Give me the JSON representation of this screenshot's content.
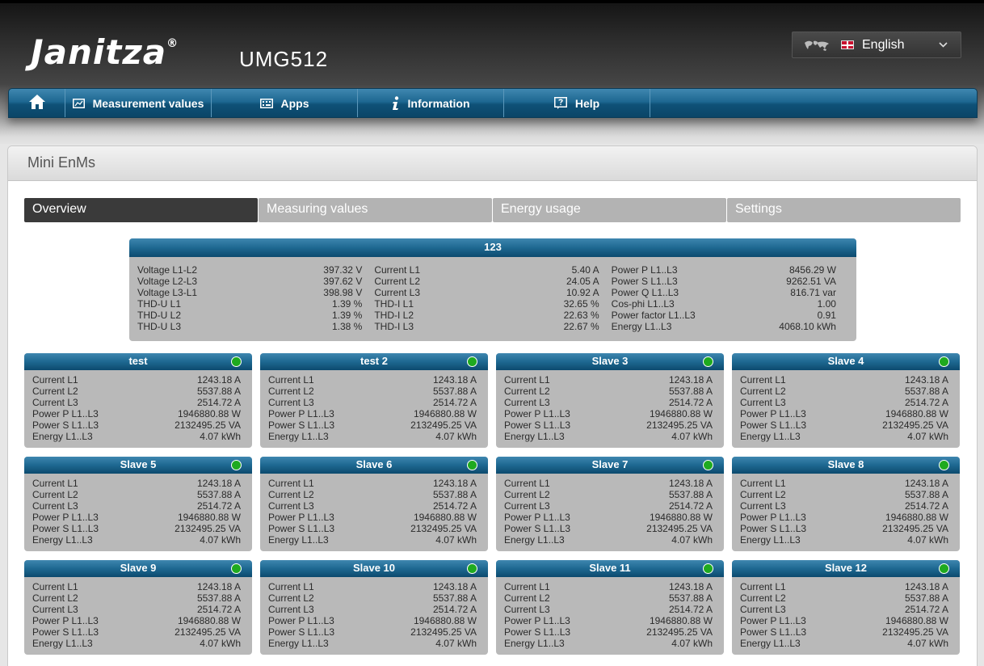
{
  "header": {
    "logo": "Janitza",
    "logo_mark": "®",
    "model": "UMG512",
    "language": {
      "icon": "globe-icon",
      "flag": "uk-flag-icon",
      "label": "English"
    }
  },
  "nav": {
    "home_icon": "home-icon",
    "items": [
      {
        "label": "Measurement values",
        "icon": "chart-icon"
      },
      {
        "label": "Apps",
        "icon": "apps-icon"
      },
      {
        "label": "Information",
        "icon": "info-icon"
      },
      {
        "label": "Help",
        "icon": "help-icon"
      }
    ]
  },
  "panel": {
    "title": "Mini EnMs"
  },
  "tabs": [
    {
      "label": "Overview",
      "active": true
    },
    {
      "label": "Measuring values",
      "active": false
    },
    {
      "label": "Energy usage",
      "active": false
    },
    {
      "label": "Settings",
      "active": false
    }
  ],
  "main_device": {
    "title": "123",
    "columns": [
      [
        {
          "label": "Voltage L1-L2",
          "value": "397.32 V"
        },
        {
          "label": "Voltage L2-L3",
          "value": "397.62 V"
        },
        {
          "label": "Voltage L3-L1",
          "value": "398.98 V"
        },
        {
          "label": "THD-U L1",
          "value": "1.39 %"
        },
        {
          "label": "THD-U L2",
          "value": "1.39 %"
        },
        {
          "label": "THD-U L3",
          "value": "1.38 %"
        }
      ],
      [
        {
          "label": "Current L1",
          "value": "5.40 A"
        },
        {
          "label": "Current L2",
          "value": "24.05 A"
        },
        {
          "label": "Current L3",
          "value": "10.92 A"
        },
        {
          "label": "THD-I L1",
          "value": "32.65 %"
        },
        {
          "label": "THD-I L2",
          "value": "22.63 %"
        },
        {
          "label": "THD-I L3",
          "value": "22.67 %"
        }
      ],
      [
        {
          "label": "Power P L1..L3",
          "value": "8456.29 W"
        },
        {
          "label": "Power S L1..L3",
          "value": "9262.51 VA"
        },
        {
          "label": "Power Q L1..L3",
          "value": "816.71 var"
        },
        {
          "label": "Cos-phi L1..L3",
          "value": "1.00"
        },
        {
          "label": "Power factor L1..L3",
          "value": "0.91"
        },
        {
          "label": "Energy L1..L3",
          "value": "4068.10 kWh"
        }
      ]
    ]
  },
  "slaves": [
    {
      "title": "test",
      "status": "online",
      "rows": [
        {
          "label": "Current L1",
          "value": "1243.18 A"
        },
        {
          "label": "Current L2",
          "value": "5537.88 A"
        },
        {
          "label": "Current L3",
          "value": "2514.72 A"
        },
        {
          "label": "Power P L1..L3",
          "value": "1946880.88 W"
        },
        {
          "label": "Power S L1..L3",
          "value": "2132495.25 VA"
        },
        {
          "label": "Energy L1..L3",
          "value": "4.07 kWh"
        }
      ]
    },
    {
      "title": "test 2",
      "status": "online",
      "rows": [
        {
          "label": "Current L1",
          "value": "1243.18 A"
        },
        {
          "label": "Current L2",
          "value": "5537.88 A"
        },
        {
          "label": "Current L3",
          "value": "2514.72 A"
        },
        {
          "label": "Power P L1..L3",
          "value": "1946880.88 W"
        },
        {
          "label": "Power S L1..L3",
          "value": "2132495.25 VA"
        },
        {
          "label": "Energy L1..L3",
          "value": "4.07 kWh"
        }
      ]
    },
    {
      "title": "Slave 3",
      "status": "online",
      "rows": [
        {
          "label": "Current L1",
          "value": "1243.18 A"
        },
        {
          "label": "Current L2",
          "value": "5537.88 A"
        },
        {
          "label": "Current L3",
          "value": "2514.72 A"
        },
        {
          "label": "Power P L1..L3",
          "value": "1946880.88 W"
        },
        {
          "label": "Power S L1..L3",
          "value": "2132495.25 VA"
        },
        {
          "label": "Energy L1..L3",
          "value": "4.07 kWh"
        }
      ]
    },
    {
      "title": "Slave 4",
      "status": "online",
      "rows": [
        {
          "label": "Current L1",
          "value": "1243.18 A"
        },
        {
          "label": "Current L2",
          "value": "5537.88 A"
        },
        {
          "label": "Current L3",
          "value": "2514.72 A"
        },
        {
          "label": "Power P L1..L3",
          "value": "1946880.88 W"
        },
        {
          "label": "Power S L1..L3",
          "value": "2132495.25 VA"
        },
        {
          "label": "Energy L1..L3",
          "value": "4.07 kWh"
        }
      ]
    },
    {
      "title": "Slave 5",
      "status": "online",
      "rows": [
        {
          "label": "Current L1",
          "value": "1243.18 A"
        },
        {
          "label": "Current L2",
          "value": "5537.88 A"
        },
        {
          "label": "Current L3",
          "value": "2514.72 A"
        },
        {
          "label": "Power P L1..L3",
          "value": "1946880.88 W"
        },
        {
          "label": "Power S L1..L3",
          "value": "2132495.25 VA"
        },
        {
          "label": "Energy L1..L3",
          "value": "4.07 kWh"
        }
      ]
    },
    {
      "title": "Slave 6",
      "status": "online",
      "rows": [
        {
          "label": "Current L1",
          "value": "1243.18 A"
        },
        {
          "label": "Current L2",
          "value": "5537.88 A"
        },
        {
          "label": "Current L3",
          "value": "2514.72 A"
        },
        {
          "label": "Power P L1..L3",
          "value": "1946880.88 W"
        },
        {
          "label": "Power S L1..L3",
          "value": "2132495.25 VA"
        },
        {
          "label": "Energy L1..L3",
          "value": "4.07 kWh"
        }
      ]
    },
    {
      "title": "Slave 7",
      "status": "online",
      "rows": [
        {
          "label": "Current L1",
          "value": "1243.18 A"
        },
        {
          "label": "Current L2",
          "value": "5537.88 A"
        },
        {
          "label": "Current L3",
          "value": "2514.72 A"
        },
        {
          "label": "Power P L1..L3",
          "value": "1946880.88 W"
        },
        {
          "label": "Power S L1..L3",
          "value": "2132495.25 VA"
        },
        {
          "label": "Energy L1..L3",
          "value": "4.07 kWh"
        }
      ]
    },
    {
      "title": "Slave 8",
      "status": "online",
      "rows": [
        {
          "label": "Current L1",
          "value": "1243.18 A"
        },
        {
          "label": "Current L2",
          "value": "5537.88 A"
        },
        {
          "label": "Current L3",
          "value": "2514.72 A"
        },
        {
          "label": "Power P L1..L3",
          "value": "1946880.88 W"
        },
        {
          "label": "Power S L1..L3",
          "value": "2132495.25 VA"
        },
        {
          "label": "Energy L1..L3",
          "value": "4.07 kWh"
        }
      ]
    },
    {
      "title": "Slave 9",
      "status": "online",
      "rows": [
        {
          "label": "Current L1",
          "value": "1243.18 A"
        },
        {
          "label": "Current L2",
          "value": "5537.88 A"
        },
        {
          "label": "Current L3",
          "value": "2514.72 A"
        },
        {
          "label": "Power P L1..L3",
          "value": "1946880.88 W"
        },
        {
          "label": "Power S L1..L3",
          "value": "2132495.25 VA"
        },
        {
          "label": "Energy L1..L3",
          "value": "4.07 kWh"
        }
      ]
    },
    {
      "title": "Slave 10",
      "status": "online",
      "rows": [
        {
          "label": "Current L1",
          "value": "1243.18 A"
        },
        {
          "label": "Current L2",
          "value": "5537.88 A"
        },
        {
          "label": "Current L3",
          "value": "2514.72 A"
        },
        {
          "label": "Power P L1..L3",
          "value": "1946880.88 W"
        },
        {
          "label": "Power S L1..L3",
          "value": "2132495.25 VA"
        },
        {
          "label": "Energy L1..L3",
          "value": "4.07 kWh"
        }
      ]
    },
    {
      "title": "Slave 11",
      "status": "online",
      "rows": [
        {
          "label": "Current L1",
          "value": "1243.18 A"
        },
        {
          "label": "Current L2",
          "value": "5537.88 A"
        },
        {
          "label": "Current L3",
          "value": "2514.72 A"
        },
        {
          "label": "Power P L1..L3",
          "value": "1946880.88 W"
        },
        {
          "label": "Power S L1..L3",
          "value": "2132495.25 VA"
        },
        {
          "label": "Energy L1..L3",
          "value": "4.07 kWh"
        }
      ]
    },
    {
      "title": "Slave 12",
      "status": "online",
      "rows": [
        {
          "label": "Current L1",
          "value": "1243.18 A"
        },
        {
          "label": "Current L2",
          "value": "5537.88 A"
        },
        {
          "label": "Current L3",
          "value": "2514.72 A"
        },
        {
          "label": "Power P L1..L3",
          "value": "1946880.88 W"
        },
        {
          "label": "Power S L1..L3",
          "value": "2132495.25 VA"
        },
        {
          "label": "Energy L1..L3",
          "value": "4.07 kWh"
        }
      ]
    }
  ],
  "colors": {
    "nav_blue": "#1e6891",
    "status_ok": "#1faa1f",
    "box_grey": "#b9b9b9"
  }
}
